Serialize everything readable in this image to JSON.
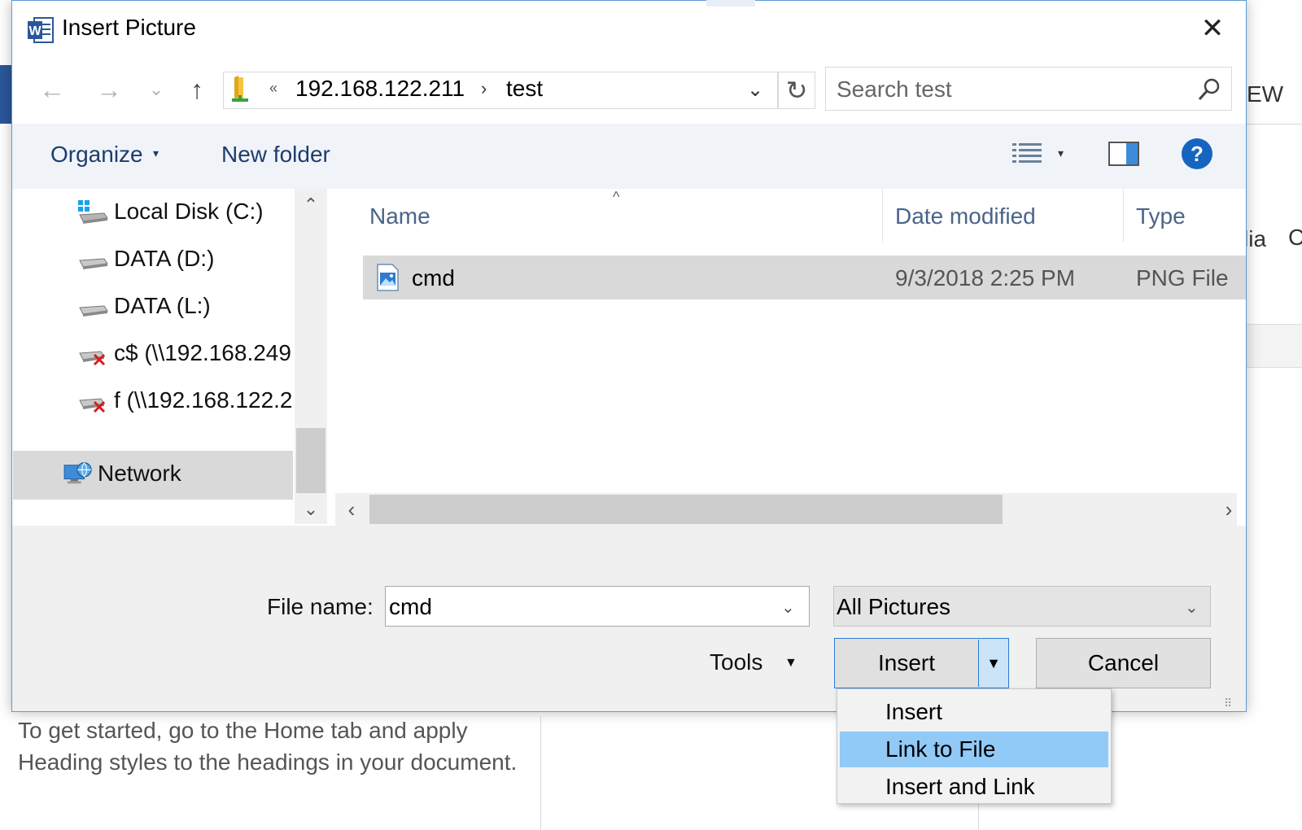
{
  "background": {
    "ribbon_view_label": "EW",
    "ribbon_media_label": "lia",
    "ribbon_gallery_label": "C",
    "nav_pane_text": "To get started, go to the Home tab and apply Heading styles to the headings in your document."
  },
  "dialog": {
    "title": "Insert Picture",
    "close_glyph": "✕"
  },
  "address_bar": {
    "overflow_chevron": "«",
    "breadcrumbs": [
      "192.168.122.211",
      "test"
    ],
    "separator": "›"
  },
  "search": {
    "placeholder": "Search test"
  },
  "toolbar": {
    "organize_label": "Organize",
    "new_folder_label": "New folder",
    "help_label": "?"
  },
  "nav_pane": {
    "items": [
      {
        "label": "Local Disk (C:)",
        "icon": "windows-drive-icon"
      },
      {
        "label": "DATA (D:)",
        "icon": "drive-icon"
      },
      {
        "label": "DATA (L:)",
        "icon": "drive-icon"
      },
      {
        "label": "c$ (\\\\192.168.249",
        "icon": "disconnected-network-drive-icon"
      },
      {
        "label": "f (\\\\192.168.122.2",
        "icon": "disconnected-network-drive-icon"
      },
      {
        "label": "Network",
        "icon": "network-icon",
        "selected": true
      }
    ]
  },
  "file_list": {
    "columns": [
      "Name",
      "Date modified",
      "Type"
    ],
    "rows": [
      {
        "name": "cmd",
        "date_modified": "9/3/2018 2:25 PM",
        "type": "PNG File",
        "selected": true
      }
    ]
  },
  "footer": {
    "filename_label": "File name:",
    "filename_value": "cmd",
    "filetype_value": "All Pictures",
    "tools_label": "Tools",
    "insert_label": "Insert",
    "cancel_label": "Cancel"
  },
  "insert_menu": {
    "items": [
      "Insert",
      "Link to File",
      "Insert and Link"
    ],
    "highlighted_index": 1
  },
  "colors": {
    "accent": "#2d7bd6",
    "menu_highlight": "#91c9f7",
    "help_icon": "#1565c0",
    "word_blue": "#2b579a"
  }
}
